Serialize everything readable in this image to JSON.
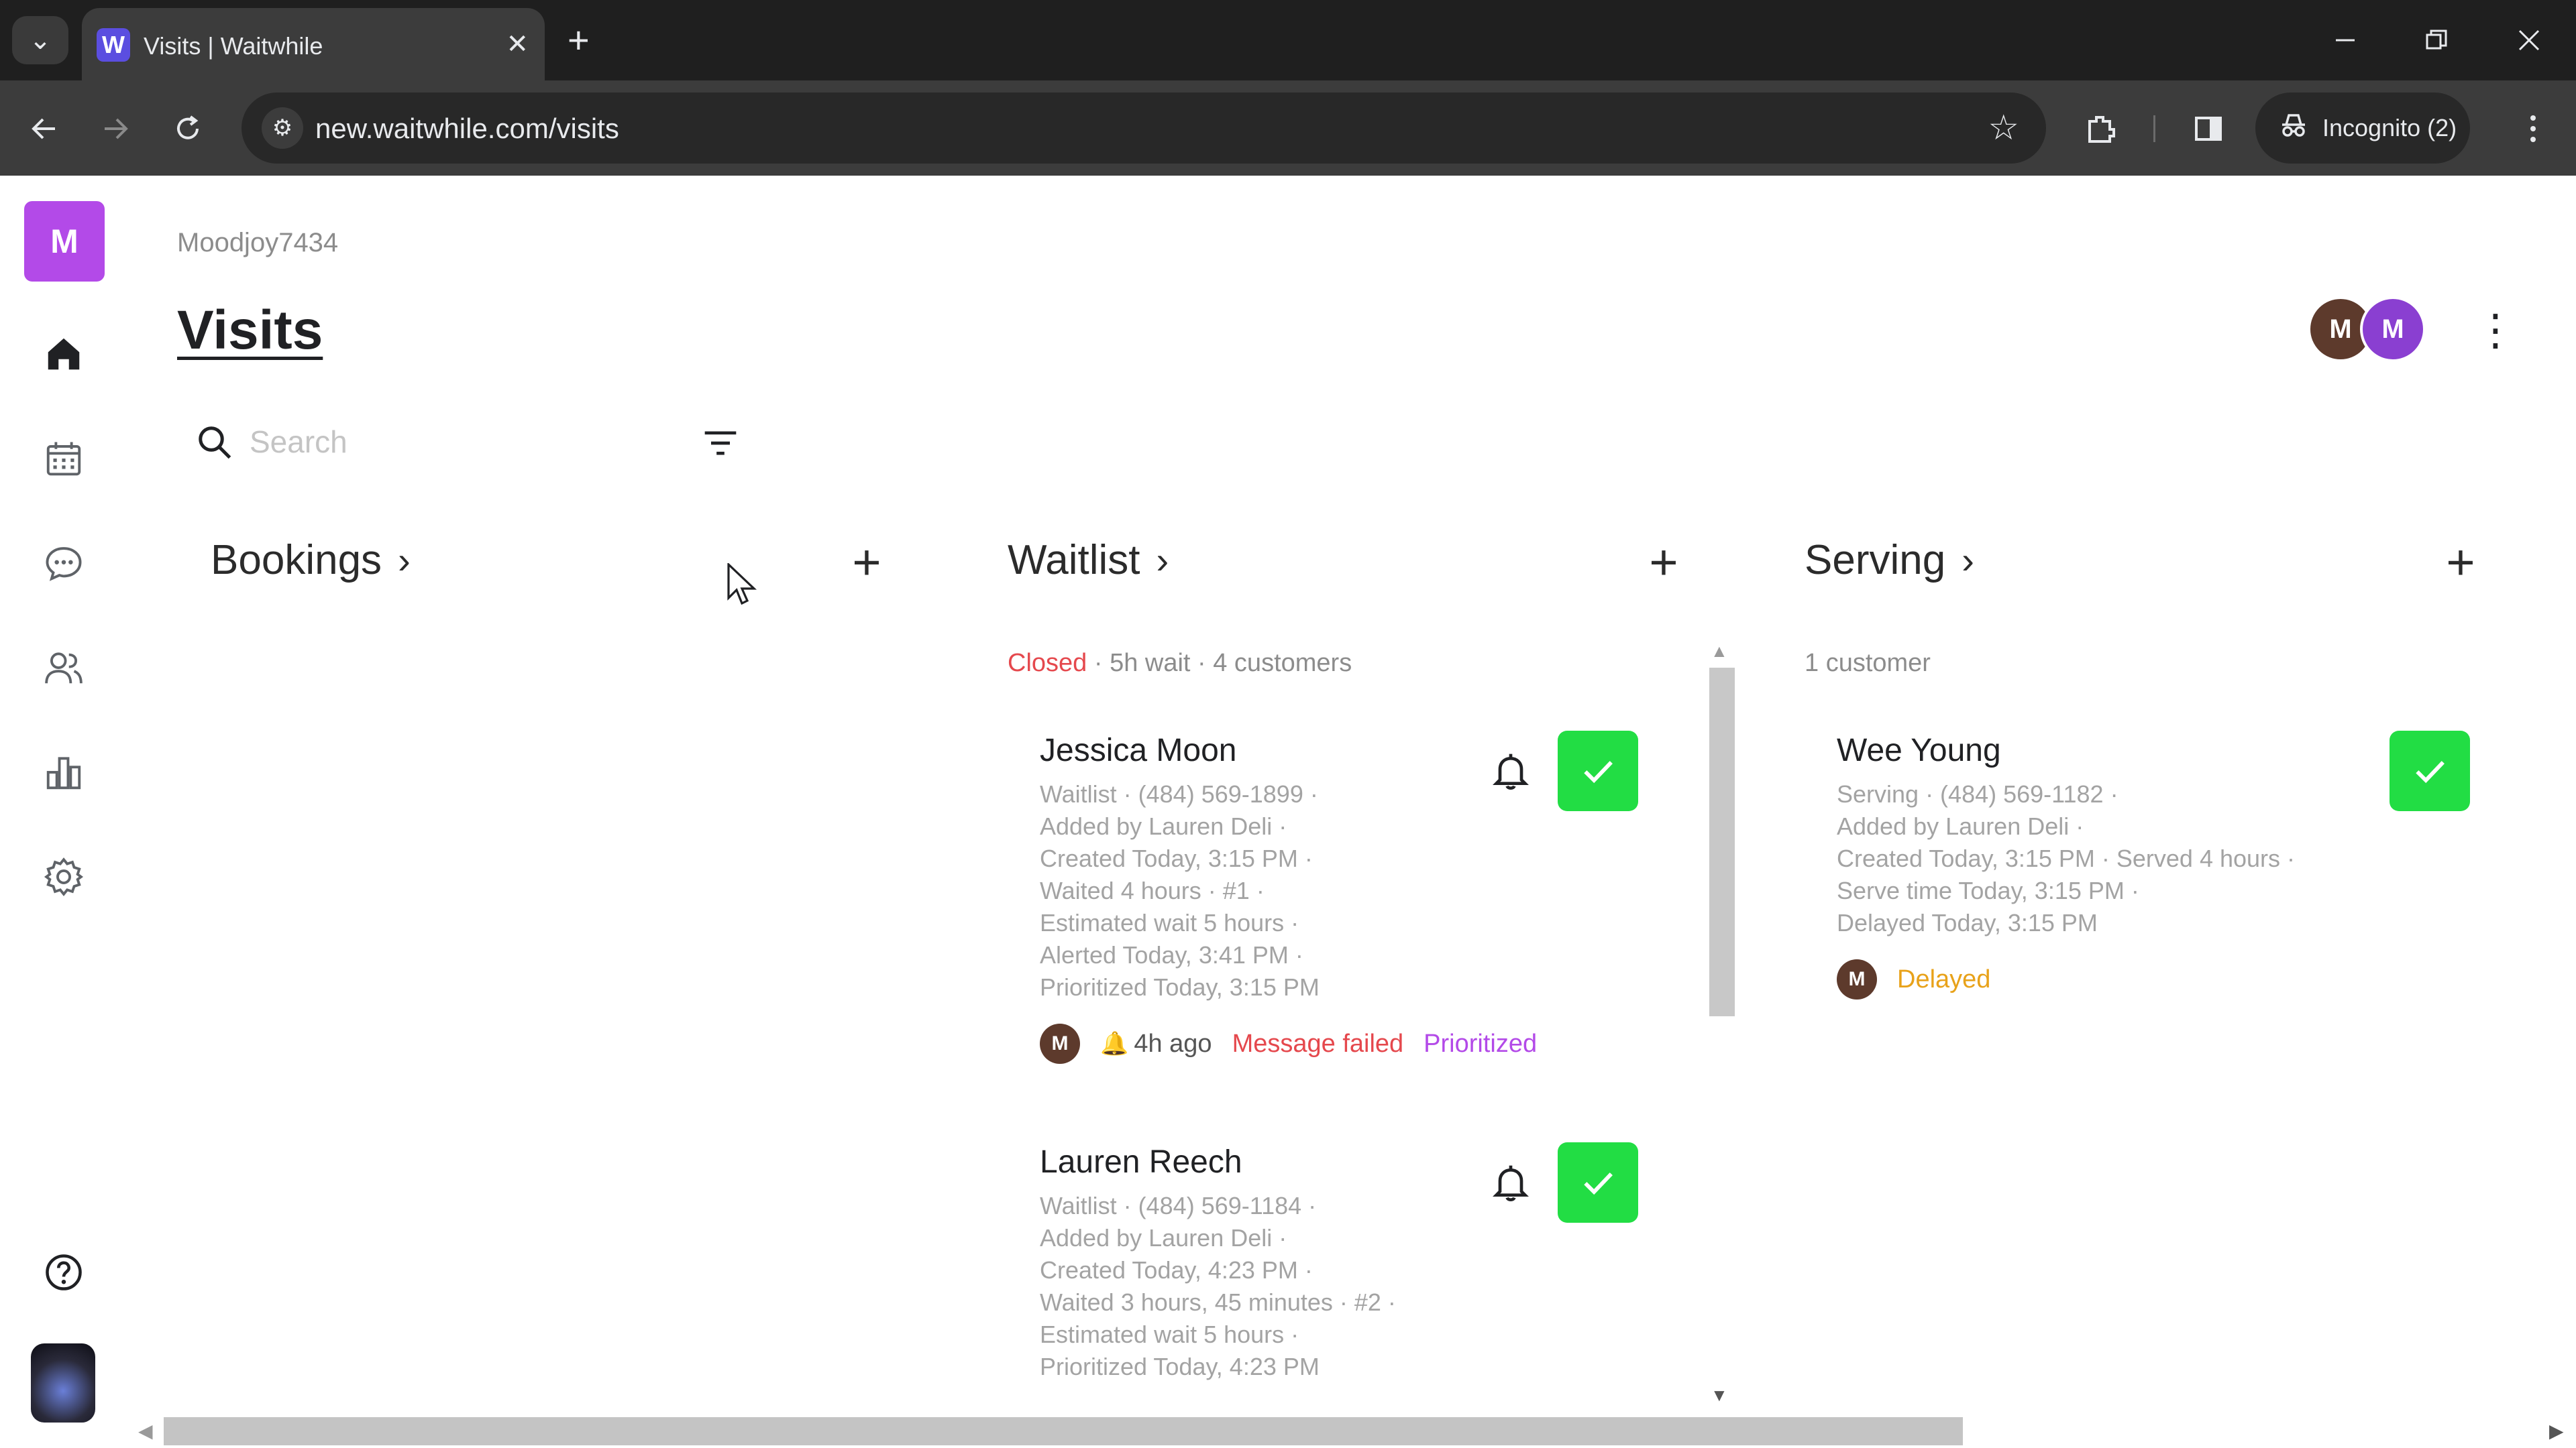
{
  "browser": {
    "tab_title": "Visits | Waitwhile",
    "favicon_letter": "W",
    "url": "new.waitwhile.com/visits",
    "incognito_label": "Incognito (2)"
  },
  "sidebar": {
    "brand_letter": "M",
    "items": [
      "home-icon",
      "calendar-icon",
      "chat-icon",
      "users-icon",
      "analytics-icon",
      "settings-icon"
    ],
    "help": "help-icon"
  },
  "header": {
    "workspace": "Moodjoy7434",
    "title": "Visits",
    "avatars": [
      {
        "letter": "M",
        "color": "#5d3a2c"
      },
      {
        "letter": "M",
        "color": "#8a3fd1"
      }
    ]
  },
  "search": {
    "placeholder": "Search"
  },
  "columns": {
    "bookings": {
      "title": "Bookings"
    },
    "waitlist": {
      "title": "Waitlist",
      "status": "Closed",
      "summary": " · 5h wait · 4 customers",
      "cards": [
        {
          "name": "Jessica Moon",
          "lines": [
            "Waitlist · (484) 569-1899 ·",
            "Added by Lauren Deli ·",
            "Created Today, 3:15 PM ·",
            "Waited 4 hours · #1 ·",
            "Estimated wait 5 hours ·",
            "Alerted Today, 3:41 PM ·",
            "Prioritized Today, 3:15 PM"
          ],
          "avatar": "M",
          "alert_time": "4h ago",
          "tag_failed": "Message failed",
          "tag_prio": "Prioritized"
        },
        {
          "name": "Lauren Reech",
          "lines": [
            "Waitlist · (484) 569-1184 ·",
            "Added by Lauren Deli ·",
            "Created Today, 4:23 PM ·",
            "Waited 3 hours, 45 minutes · #2 ·",
            "Estimated wait 5 hours ·",
            "Prioritized Today, 4:23 PM"
          ]
        }
      ]
    },
    "serving": {
      "title": "Serving",
      "summary": "1 customer",
      "cards": [
        {
          "name": "Wee Young",
          "lines": [
            "Serving · (484) 569-1182 ·",
            "Added by Lauren Deli ·",
            "Created Today, 3:15 PM · Served 4 hours ·",
            "Serve time Today, 3:15 PM ·",
            "Delayed Today, 3:15 PM"
          ],
          "avatar": "M",
          "tag_delay": "Delayed"
        }
      ]
    }
  },
  "colors": {
    "accent": "#b34ae8",
    "check": "#22dd44",
    "danger": "#e5484d",
    "warning": "#e8a21a"
  }
}
